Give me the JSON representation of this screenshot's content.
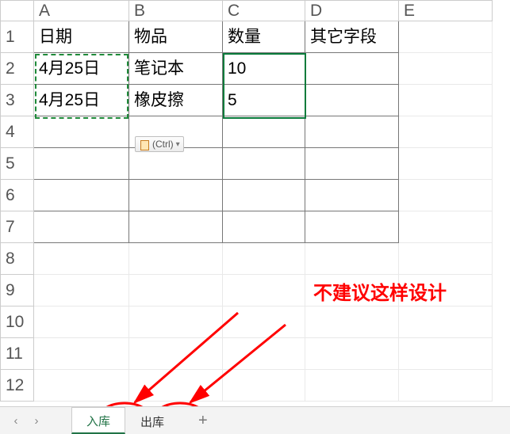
{
  "columns": [
    "A",
    "B",
    "C",
    "D",
    "E"
  ],
  "rows": [
    "1",
    "2",
    "3",
    "4",
    "5",
    "6",
    "7",
    "8",
    "9",
    "10",
    "11",
    "12"
  ],
  "headers": {
    "A": "日期",
    "B": "物品",
    "C": "数量",
    "D": "其它字段"
  },
  "data": {
    "r2": {
      "A": "4月25日",
      "B": "笔记本",
      "C": "10"
    },
    "r3": {
      "A": "4月25日",
      "B": "橡皮擦",
      "C": "5"
    }
  },
  "smarttag": {
    "label": "(Ctrl)"
  },
  "annotation": {
    "text": "不建议这样设计"
  },
  "tabs": {
    "items": [
      {
        "label": "入库",
        "active": true
      },
      {
        "label": "出库",
        "active": false
      }
    ],
    "add": "+"
  },
  "nav": {
    "prev": "‹",
    "next": "›"
  },
  "chart_data": {
    "type": "table",
    "title": "",
    "columns": [
      "日期",
      "物品",
      "数量",
      "其它字段"
    ],
    "rows": [
      [
        "4月25日",
        "笔记本",
        10,
        ""
      ],
      [
        "4月25日",
        "橡皮擦",
        5,
        ""
      ]
    ]
  }
}
